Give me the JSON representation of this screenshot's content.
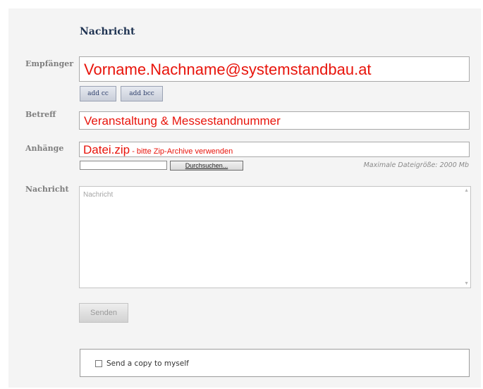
{
  "form": {
    "title": "Nachricht",
    "recipient": {
      "label": "Empfänger",
      "value": "Vorname.Nachname@systemstandbau.at",
      "add_cc_label": "add cc",
      "add_bcc_label": "add bcc"
    },
    "subject": {
      "label": "Betreff",
      "value": "Veranstaltung & Messestandnummer"
    },
    "attachments": {
      "label": "Anhänge",
      "value_main": "Datei.zip",
      "value_note": " - bitte Zip-Archive verwenden",
      "browse_label": "Durchsuchen...",
      "max_size_text": "Maximale Dateigröße: 2000 Mb"
    },
    "message": {
      "label": "Nachricht",
      "placeholder": "Nachricht"
    },
    "send_label": "Senden",
    "copy_label": "Send a copy to myself"
  },
  "colors": {
    "title": "#1f3352",
    "label": "#7e7e7e",
    "annotation_red": "#e8140b",
    "panel_bg": "#f4f4f4"
  },
  "icons": {
    "checkbox": "checkbox-unchecked-icon",
    "scroll_up": "scroll-up-arrow-icon",
    "scroll_down": "scroll-down-arrow-icon"
  }
}
